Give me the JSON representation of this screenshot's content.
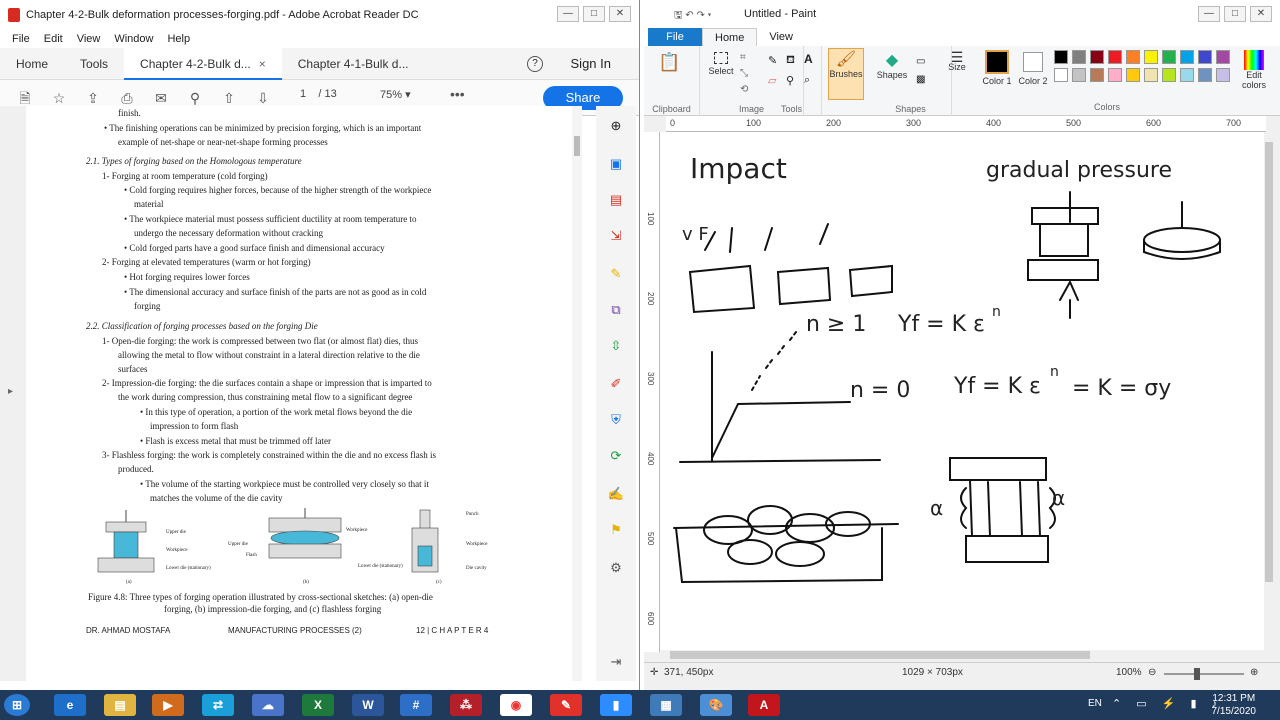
{
  "acrobat": {
    "title": "Chapter 4-2-Bulk deformation processes-forging.pdf - Adobe Acrobat Reader DC",
    "menu": [
      "File",
      "Edit",
      "View",
      "Window",
      "Help"
    ],
    "tabs": {
      "home": "Home",
      "tools": "Tools",
      "doc1": "Chapter 4-2-Bulk d...",
      "doc2": "Chapter 4-1-Bulk d...",
      "signin": "Sign In",
      "close": "×"
    },
    "toolbar": {
      "page_current": "1",
      "page_total": "/ 13",
      "zoom": "75%",
      "share": "Share"
    },
    "doc_lines": [
      "finish.",
      "•  The finishing operations can be minimized by precision forging, which is an important",
      "example of net-shape or near-net-shape forming processes",
      "2.1. Types of forging based on the Homologous temperature",
      "1-   Forging at room temperature (cold forging)",
      "•  Cold forging requires higher forces, because of the higher strength of the workpiece",
      "material",
      "•  The workpiece material must possess sufficient ductility at room temperature to",
      "undergo the necessary deformation without cracking",
      "•  Cold forged parts have a good surface finish and dimensional accuracy",
      "2-   Forging at elevated temperatures (warm or hot forging)",
      "•  Hot forging requires lower forces",
      "•  The dimensional accuracy and surface finish of the parts are not as good as in cold",
      "forging",
      "2.2. Classification of forging processes based on the forging Die",
      "1-   Open-die forging: the work is compressed between two flat (or almost flat) dies, thus",
      "allowing the metal to flow without constraint in a lateral direction relative to the die",
      "surfaces",
      "2-   Impression-die forging: the die surfaces contain a shape or impression that is imparted to",
      "the work during compression, thus constraining metal flow to a significant degree",
      "•  In this type of operation, a portion of the work metal flows beyond the die",
      "impression to form flash",
      "•  Flash is excess metal that must be trimmed off later",
      "3-   Flashless forging: the work is completely constrained within the die and no excess flash is",
      "produced.",
      "•  The volume of the starting workpiece must be controlled very closely so that it",
      "matches the volume of the die cavity"
    ],
    "figure": {
      "labels_a": [
        "Upper die",
        "Workpiece",
        "Lower die (stationary)"
      ],
      "labels_b": [
        "Workpiece",
        "Upper die",
        "Flash",
        "Lower die (stationary)"
      ],
      "labels_c": [
        "Punch",
        "Workpiece",
        "Die cavity"
      ],
      "sub": [
        "(a)",
        "(b)",
        "(c)"
      ],
      "caption1": "Figure 4.8: Three types of forging operation illustrated by cross-sectional sketches: (a) open-die",
      "caption2": "forging, (b) impression-die forging, and (c) flashless forging"
    },
    "footer": {
      "author": "DR. AHMAD MOSTAFA",
      "course": "MANUFACTURING PROCESSES (2)",
      "page": "12 | C H A P T E R  4"
    }
  },
  "paint": {
    "title": "Untitled - Paint",
    "tabs": {
      "file": "File",
      "home": "Home",
      "view": "View"
    },
    "groups": {
      "clipboard": "Clipboard",
      "image": "Image",
      "tools": "Tools",
      "shapes": "Shapes",
      "colors": "Colors"
    },
    "buttons": {
      "select": "Select",
      "brushes": "Brushes",
      "shapes": "Shapes",
      "size": "Size",
      "color1": "Color 1",
      "color2": "Color 2",
      "edit_colors": "Edit colors"
    },
    "ruler_h": [
      "0",
      "100",
      "200",
      "300",
      "400",
      "500",
      "600",
      "700"
    ],
    "ruler_v": [
      "100",
      "200",
      "300",
      "400",
      "500",
      "600"
    ],
    "palette": [
      "#000000",
      "#7f7f7f",
      "#880015",
      "#ed1c24",
      "#ff7f27",
      "#fff200",
      "#22b14c",
      "#00a2e8",
      "#3f48cc",
      "#a349a4",
      "#ffffff",
      "#c3c3c3",
      "#b97a57",
      "#ffaec9",
      "#ffc90e",
      "#efe4b0",
      "#b5e61d",
      "#99d9ea",
      "#7092be",
      "#c8bfe7"
    ],
    "canvas_text": {
      "impact": "Impact",
      "gradual": "gradual pressure",
      "n_ge": "n ≥ 1",
      "yf1": "Yf = K ε",
      "n_sup": "n",
      "n_eq": "n = 0",
      "yf2": "Yf = K ε",
      "n_sup2": "n",
      "eq_k": "= K = σy",
      "alpha": "α",
      "vf": "v F"
    },
    "status": {
      "coords": "371, 450px",
      "size": "1029 × 703px",
      "zoom": "100%"
    }
  },
  "taskbar": {
    "lang": "EN",
    "time": "12:31 PM",
    "date": "7/15/2020"
  }
}
